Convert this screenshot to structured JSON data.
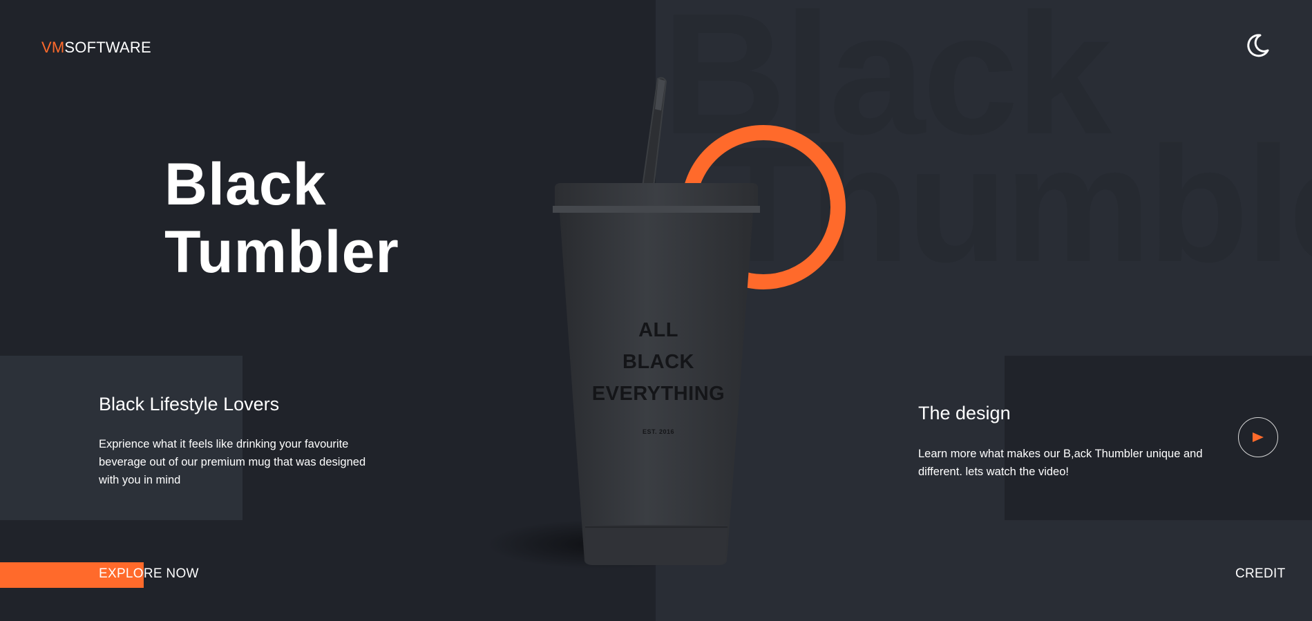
{
  "brand": {
    "logo_accent": "VM",
    "logo_rest": "SOFTWARE"
  },
  "header": {
    "theme_toggle_icon": "moon-icon"
  },
  "background": {
    "word_line_1": "Black",
    "word_line_2": "Thumble"
  },
  "hero": {
    "title_line_1": "Black",
    "title_line_2": "Tumbler"
  },
  "product": {
    "print_line_1": "ALL",
    "print_line_2": "BLACK",
    "print_line_3": "EVERYTHING",
    "print_est": "EST. 2016"
  },
  "left_card": {
    "title": "Black Lifestyle Lovers",
    "text": "Exprience what it feels like drinking your favourite beverage out of our premium mug that was designed with you in mind"
  },
  "right_card": {
    "title": "The design",
    "text": "Learn more what makes our B,ack Thumbler unique and different. lets watch the video!",
    "play_icon": "play-icon"
  },
  "footer": {
    "explore_label": "EXPLORE NOW",
    "credit_label": "CREDIT"
  },
  "colors": {
    "accent": "#ff6a2b",
    "background_dark": "#20232a",
    "background_panel": "#292d35",
    "card_light": "#2c3139",
    "text": "#ffffff"
  }
}
